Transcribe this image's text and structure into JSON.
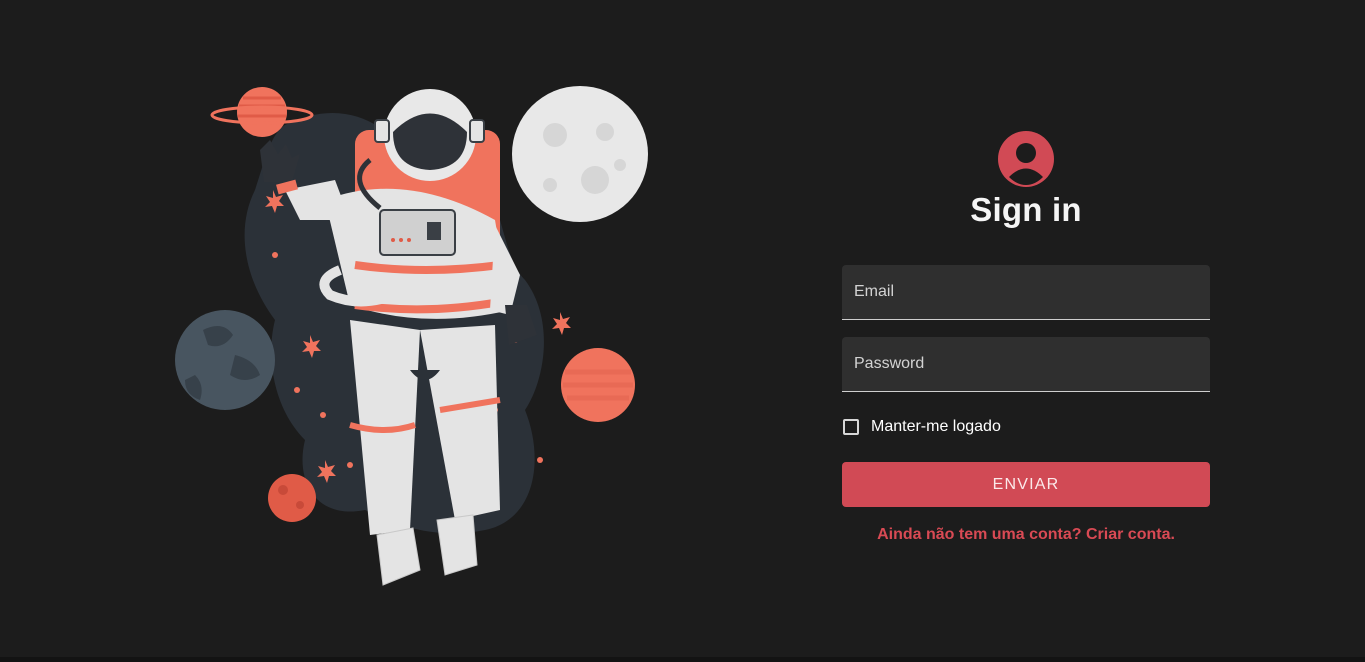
{
  "illustration": {
    "icon": "astronaut-illustration"
  },
  "signin": {
    "avatar_icon": "user-circle-icon",
    "title": "Sign in",
    "email_placeholder": "Email",
    "password_placeholder": "Password",
    "remember_label": "Manter-me logado",
    "remember_checked": false,
    "submit_label": "ENVIAR",
    "signup_link": "Ainda não tem uma conta? Criar conta."
  },
  "colors": {
    "background": "#1c1c1c",
    "accent": "#d14a55",
    "field_bg": "#2f2f2f"
  }
}
